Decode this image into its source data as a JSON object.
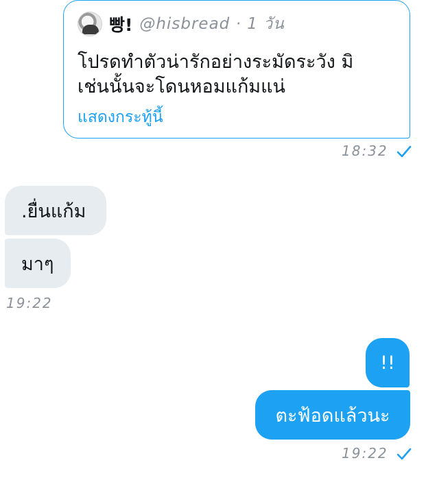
{
  "quoted_tweet": {
    "display_name": "빵!",
    "handle_time": "@hisbread · 1 วัน",
    "text_line1": "โปรดทำตัวน่ารักอย่างระมัดระวัง มิ",
    "text_line2": "เช่นนั้นจะโดนหอมแก้มแน่",
    "show_thread": "แสดงกระทู้นี้"
  },
  "messages": {
    "sent_time_1": "18:32",
    "incoming": [
      {
        "text": ".ยื่นแก้ม"
      },
      {
        "text": "มาๆ"
      }
    ],
    "incoming_time": "19:22",
    "outgoing": [
      {
        "text": "!!"
      },
      {
        "text": "ตะฟ้อดแล้วนะ"
      }
    ],
    "sent_time_2": "19:22"
  },
  "colors": {
    "accent": "#1da1f2",
    "incoming_bubble": "#e6ecf0",
    "muted_text": "#8a9199"
  },
  "icons": {
    "read_receipt": "checkmark-icon",
    "avatar": "avatar"
  }
}
